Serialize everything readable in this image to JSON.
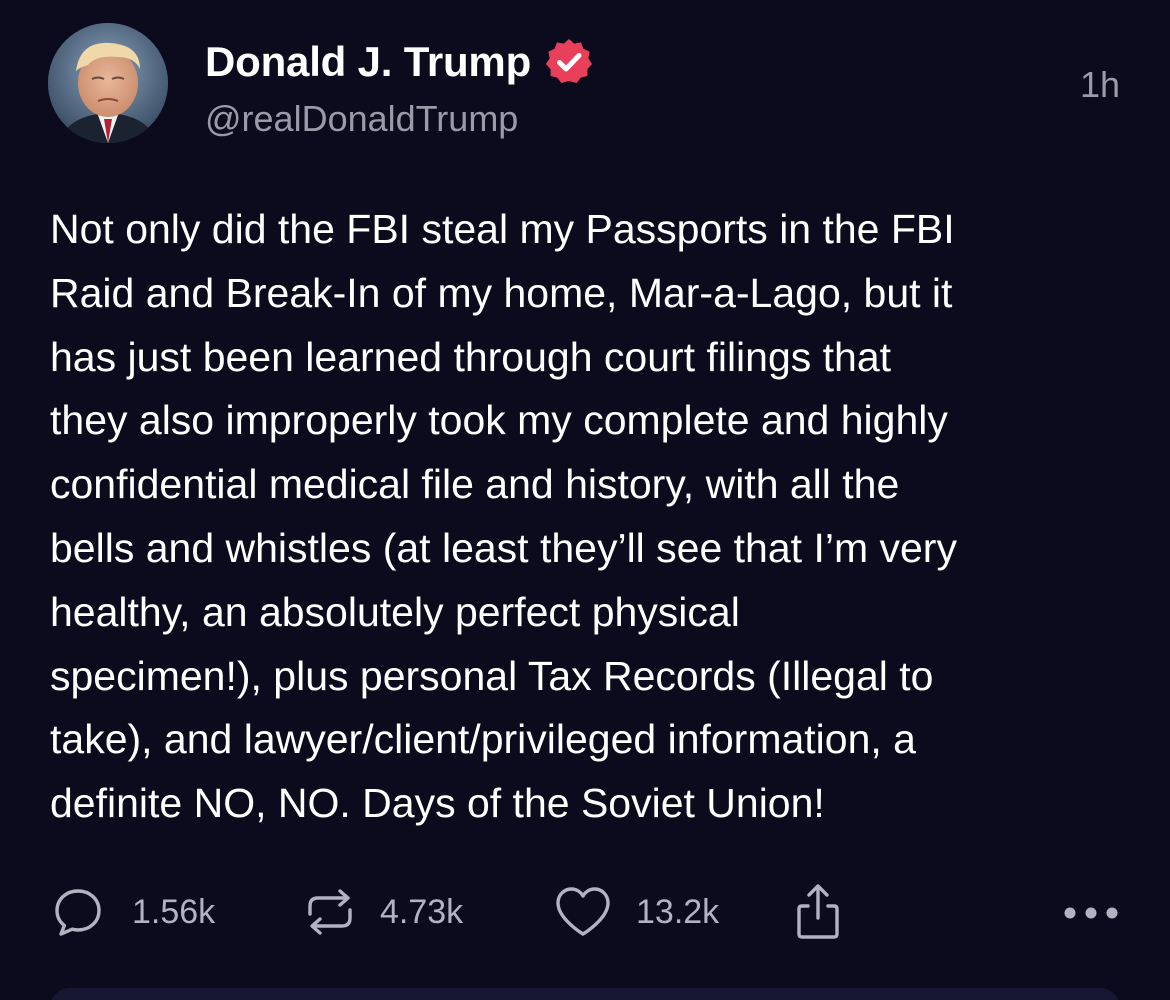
{
  "post": {
    "display_name": "Donald J. Trump",
    "handle": "@realDonaldTrump",
    "time": "1h",
    "verified_icon": "verified-badge-icon",
    "avatar": "profile-photo",
    "text_lines": [
      "Not only did the FBI steal my Passports in the FBI",
      "Raid and Break-In of my home, Mar-a-Lago, but it",
      "has just been learned through court filings that",
      "they also improperly took my complete and highly",
      "confidential medical file and history, with all the",
      "bells and whistles (at least they’ll see that I’m very",
      "healthy, an absolutely perfect physical",
      "specimen!), plus personal Tax Records (Illegal to",
      "take), and lawyer/client/privileged information, a",
      "definite NO, NO. Days of the Soviet Union!"
    ]
  },
  "actions": {
    "replies": {
      "icon": "reply-icon",
      "count": "1.56k"
    },
    "reposts": {
      "icon": "repost-icon",
      "count": "4.73k"
    },
    "likes": {
      "icon": "heart-icon",
      "count": "13.2k"
    },
    "share": {
      "icon": "share-icon"
    },
    "more": {
      "icon": "more-icon"
    }
  },
  "colors": {
    "background": "#0c0b1e",
    "text_primary": "#ffffff",
    "text_secondary": "#9c9aa8",
    "verified_badge": "#e8405a"
  }
}
